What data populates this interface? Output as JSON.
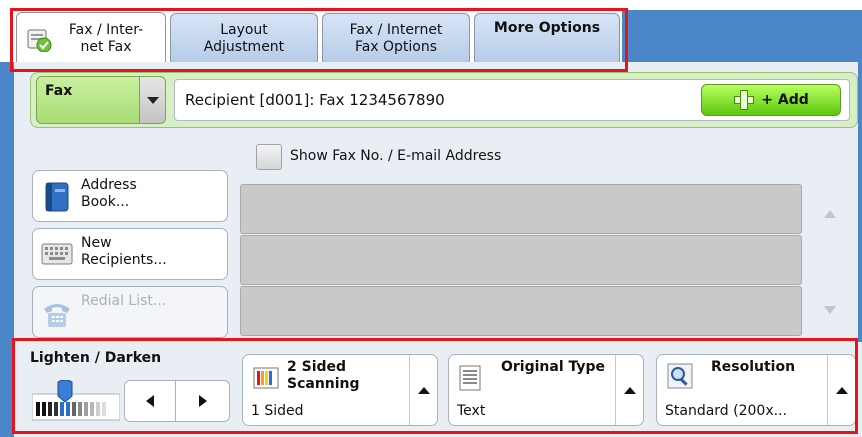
{
  "tabs": [
    {
      "line1": "Fax / Inter-",
      "line2": "net Fax",
      "active": true
    },
    {
      "line1": "Layout",
      "line2": "Adjustment",
      "active": false
    },
    {
      "line1": "Fax / Internet",
      "line2": "Fax Options",
      "active": false
    },
    {
      "line1": "More Options",
      "line2": "",
      "active": false
    }
  ],
  "service": {
    "selected": "Fax",
    "recipient_text": "Recipient [d001]: Fax  1234567890",
    "add_label": "+ Add"
  },
  "side_buttons": [
    {
      "line1": "Address",
      "line2": "Book...",
      "icon": "address-book-icon",
      "enabled": true
    },
    {
      "line1": "New",
      "line2": "Recipients...",
      "icon": "keyboard-icon",
      "enabled": true
    },
    {
      "line1": "Redial List...",
      "line2": "",
      "icon": "phone-icon",
      "enabled": false
    }
  ],
  "show_fax_checkbox": {
    "label": "Show Fax No. / E-mail Address",
    "checked": false
  },
  "recipient_list": {
    "rows": [
      "",
      "",
      ""
    ]
  },
  "bottom": {
    "lighten_darken": {
      "label": "Lighten / Darken",
      "level": 0.5
    },
    "two_sided": {
      "title_line1": "2 Sided",
      "title_line2": "Scanning",
      "value": "1 Sided",
      "icon": "two-sided-icon"
    },
    "original_type": {
      "title": "Original Type",
      "value": "Text",
      "icon": "document-icon"
    },
    "resolution": {
      "title": "Resolution",
      "value": "Standard (200x...",
      "icon": "magnifier-icon"
    }
  },
  "colors": {
    "highlight": "#e8141c",
    "accent_blue": "#4a86c8",
    "add_green": "#5cc80c"
  }
}
